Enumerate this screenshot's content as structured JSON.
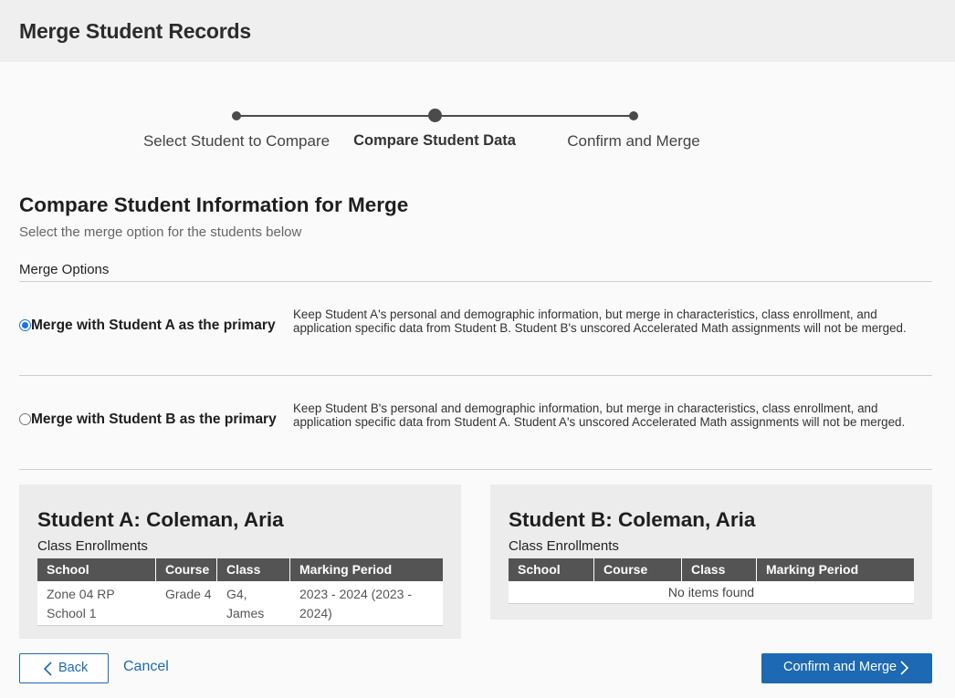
{
  "header": {
    "title": "Merge Student Records"
  },
  "stepper": {
    "steps": [
      {
        "label": "Select Student to Compare",
        "active": false
      },
      {
        "label": "Compare Student Data",
        "active": true
      },
      {
        "label": "Confirm and Merge",
        "active": false
      }
    ]
  },
  "compare": {
    "title": "Compare Student Information for Merge",
    "subtitle": "Select the merge option for the students below",
    "options_label": "Merge Options"
  },
  "merge_options": [
    {
      "label": "Merge with Student A as the primary",
      "selected": true,
      "description": "Keep Student A's personal and demographic information, but merge in characteristics, class enrollment, and application specific data from Student B. Student B's unscored Accelerated Math assignments will not be merged."
    },
    {
      "label": "Merge with Student B as the primary",
      "selected": false,
      "description": "Keep Student B's personal and demographic information, but merge in characteristics, class enrollment, and application specific data from Student A. Student A's unscored Accelerated Math assignments will not be merged."
    }
  ],
  "table_columns": [
    "School",
    "Course",
    "Class",
    "Marking Period"
  ],
  "student_a": {
    "title": "Student A: Coleman, Aria",
    "enrollments_label": "Class Enrollments",
    "rows": [
      {
        "school": "Zone 04 RP School 1",
        "course": "Grade 4",
        "class": "G4, James",
        "marking_period": "2023 - 2024 (2023 - 2024)"
      }
    ]
  },
  "student_b": {
    "title": "Student B: Coleman, Aria",
    "enrollments_label": "Class Enrollments",
    "empty_text": "No items found"
  },
  "footer": {
    "back_label": "Back",
    "cancel_label": "Cancel",
    "confirm_label": "Confirm and Merge"
  },
  "colors": {
    "accent": "#1d69b3",
    "header_bg": "#efefef",
    "table_header": "#545454"
  }
}
